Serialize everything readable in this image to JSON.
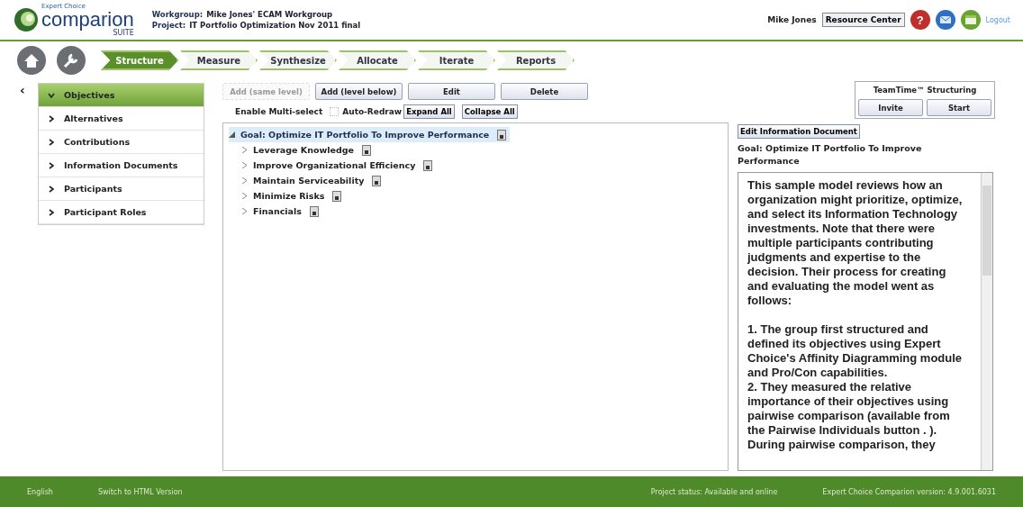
{
  "header": {
    "brand_small": "Expert Choice",
    "brand": "comparion",
    "brand_sub": "SUITE",
    "workgroup_label": "Workgroup:",
    "workgroup": "Mike Jones' ECAM Workgroup",
    "project_label": "Project:",
    "project": "IT Portfolio Optimization Nov 2011 final",
    "user": "Mike Jones",
    "resource_button": "Resource Center",
    "help_icon": "?",
    "logout": "Logout"
  },
  "steps": [
    {
      "label": "Structure",
      "selected": true
    },
    {
      "label": "Measure",
      "selected": false
    },
    {
      "label": "Synthesize",
      "selected": false
    },
    {
      "label": "Allocate",
      "selected": false
    },
    {
      "label": "Iterate",
      "selected": false
    },
    {
      "label": "Reports",
      "selected": false
    }
  ],
  "collapse_icon": "‹",
  "sidebar": [
    {
      "label": "Objectives",
      "selected": true
    },
    {
      "label": "Alternatives",
      "selected": false
    },
    {
      "label": "Contributions",
      "selected": false
    },
    {
      "label": "Information Documents",
      "selected": false
    },
    {
      "label": "Participants",
      "selected": false
    },
    {
      "label": "Participant Roles",
      "selected": false
    }
  ],
  "toolbar": [
    {
      "label": "Add (same level)",
      "disabled": true
    },
    {
      "label": "Add (level below)",
      "disabled": false
    },
    {
      "label": "Edit",
      "disabled": false
    },
    {
      "label": "Delete",
      "disabled": false
    }
  ],
  "options": [
    {
      "kind": "text",
      "label": "Enable Multi-select"
    },
    {
      "kind": "checkbox",
      "label": "Auto-Redraw",
      "checked": false
    },
    {
      "kind": "button",
      "label": "Expand All"
    },
    {
      "kind": "button",
      "label": "Collapse All"
    }
  ],
  "tree": [
    {
      "label": "Goal: Optimize IT Portfolio To Improve Performance",
      "selected": true,
      "expanded": true,
      "children": [
        {
          "label": "Leverage Knowledge",
          "selected": false,
          "expanded": false
        },
        {
          "label": "Improve Organizational Efficiency",
          "selected": false,
          "expanded": false
        },
        {
          "label": "Maintain Serviceability",
          "selected": false,
          "expanded": false
        },
        {
          "label": "Minimize Risks",
          "selected": false,
          "expanded": false
        },
        {
          "label": "Financials",
          "selected": false,
          "expanded": false
        }
      ]
    }
  ],
  "teamtime": {
    "title": "TeamTime™ Structuring",
    "buttons": [
      "Invite",
      "Start"
    ]
  },
  "info": {
    "edit_button": "Edit Information Document",
    "title": "Goal: Optimize IT Portfolio To Improve Performance",
    "paragraphs": [
      "This sample model reviews how an organization might prioritize, optimize, and select its Information Technology investments.  Note that there were multiple participants contributing judgments and expertise to the decision.  Their process for creating and evaluating the model went as follows:",
      "1. The group first structured and defined its objectives using Expert Choice's Affinity Diagramming module and Pro/Con capabilities.",
      "2. They measured the relative importance of their objectives using pairwise comparison (available from the Pairwise Individuals button . ). During pairwise comparison, they"
    ]
  },
  "footer": {
    "language": "English",
    "switch_link": "Switch to HTML Version",
    "status": "Project status: Available and online",
    "version": "Expert Choice Comparion version:  4.9.001.6031"
  }
}
